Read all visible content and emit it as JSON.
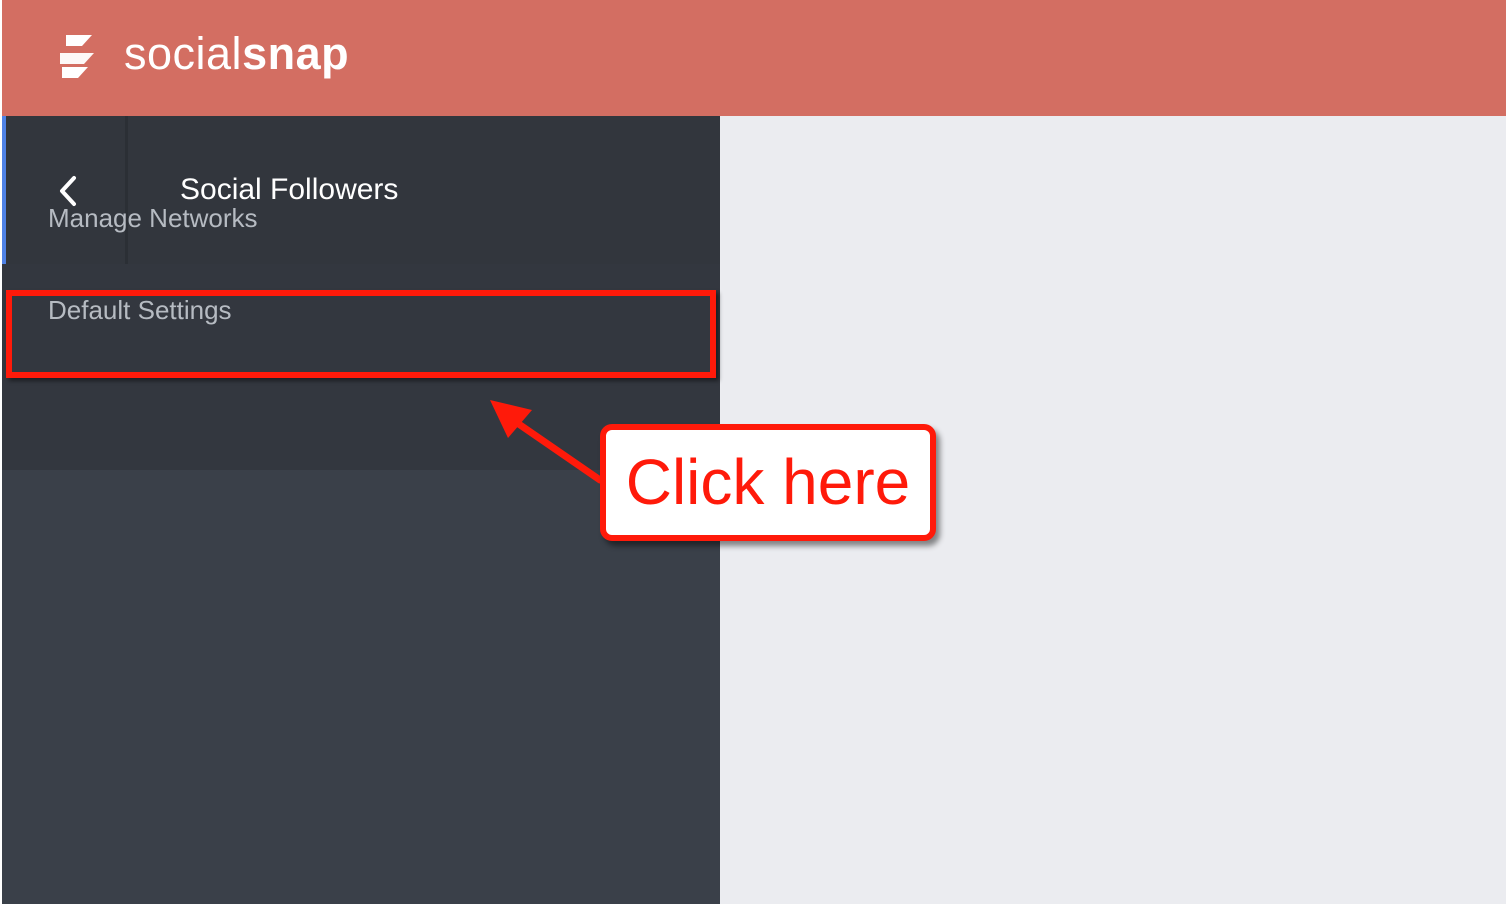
{
  "header": {
    "logo_icon": "socialsnap-logo-icon",
    "brand_thin": "social",
    "brand_bold": "snap",
    "background_color": "#d36e62"
  },
  "sidebar": {
    "back_icon": "chevron-left-icon",
    "title": "Social Followers",
    "items": [
      {
        "label": "Manage Networks"
      },
      {
        "label": "Default Settings"
      }
    ],
    "accent_color": "#4f82e6"
  },
  "annotation": {
    "callout_text": "Click here",
    "color": "#ff1a0a"
  }
}
